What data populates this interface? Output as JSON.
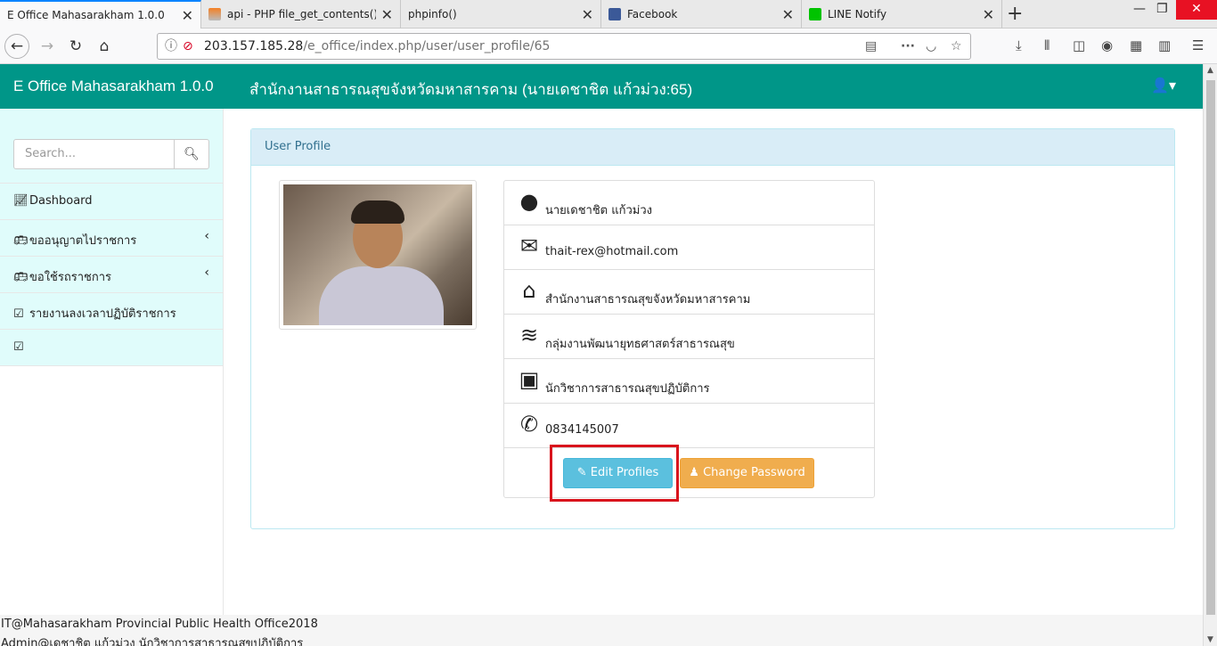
{
  "browser": {
    "tabs": [
      {
        "title": "E Office Mahasarakham 1.0.0",
        "icon": "none"
      },
      {
        "title": "api - PHP file_get_contents() re",
        "icon": "stackoverflow-icon"
      },
      {
        "title": "phpinfo()",
        "icon": "none"
      },
      {
        "title": "Facebook",
        "icon": "facebook-icon"
      },
      {
        "title": "LINE Notify",
        "icon": "line-icon"
      }
    ],
    "url_host": "203.157.185.28",
    "url_path": "/e_office/index.php/user/user_profile/65",
    "colors": {
      "active_tab_accent": "#0a84ff",
      "close_window": "#e81123"
    }
  },
  "header": {
    "brand": "E Office Mahasarakham 1.0.0",
    "org": "สำนักงานสาธารณสุขจังหวัดมหาสารคาม (นายเดชาชิต แก้วม่วง:65)",
    "color": "#009688"
  },
  "sidebar": {
    "search_placeholder": "Search...",
    "items": [
      {
        "label": "Dashboard",
        "icon": "chart-icon",
        "has_children": false
      },
      {
        "label": "ขออนุญาตไปราชการ",
        "icon": "bus-icon",
        "has_children": true
      },
      {
        "label": "ขอใช้รถราชการ",
        "icon": "bus-icon",
        "has_children": true
      },
      {
        "label": "รายงานลงเวลาปฏิบัติราชการ",
        "icon": "calendar-check-icon",
        "has_children": false
      },
      {
        "label": "",
        "icon": "calendar-check-icon",
        "has_children": false
      }
    ]
  },
  "panel": {
    "title": "User Profile",
    "rows": [
      {
        "icon": "user-circle-icon",
        "text": "นายเดชาชิต แก้วม่วง"
      },
      {
        "icon": "envelope-icon",
        "text": "thait-rex@hotmail.com"
      },
      {
        "icon": "home-icon",
        "text": "สำนักงานสาธารณสุขจังหวัดมหาสารคาม"
      },
      {
        "icon": "layers-icon",
        "text": "กลุ่มงานพัฒนายุทธศาสตร์สาธารณสุข"
      },
      {
        "icon": "address-card-icon",
        "text": "นักวิชาการสาธารณสุขปฏิบัติการ"
      },
      {
        "icon": "phone-icon",
        "text": "0834145007"
      }
    ],
    "edit_label": "Edit Profiles",
    "password_label": "Change Password"
  },
  "footer": {
    "line1": "IT@Mahasarakham Provincial Public Health Office2018",
    "line2": "Admin@เดชาชิต แก้วม่วง นักวิชาการสาธารณสุขปฏิบัติการ"
  }
}
